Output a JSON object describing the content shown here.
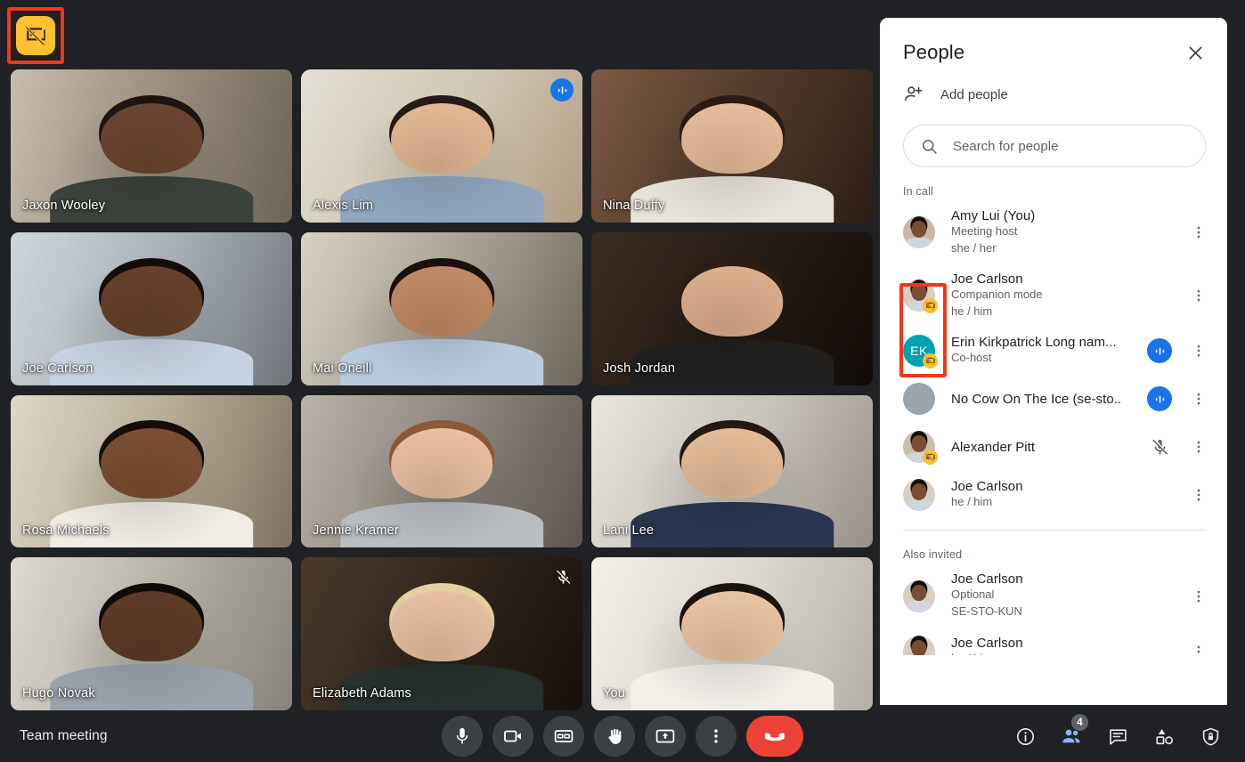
{
  "meeting": {
    "title": "Team meeting",
    "companion_indicator_icon": "companion-mode-off-icon"
  },
  "video_grid": {
    "tiles": [
      {
        "name": "Jaxon Wooley",
        "speaking": false,
        "muted": false,
        "audio_active": false
      },
      {
        "name": "Alexis Lim",
        "speaking": true,
        "muted": false,
        "audio_active": true
      },
      {
        "name": "Nina Duffy",
        "speaking": false,
        "muted": false,
        "audio_active": false
      },
      {
        "name": "Joe Carlson",
        "speaking": false,
        "muted": false,
        "audio_active": false
      },
      {
        "name": "Mai Oneill",
        "speaking": false,
        "muted": false,
        "audio_active": false
      },
      {
        "name": "Josh Jordan",
        "speaking": false,
        "muted": false,
        "audio_active": false
      },
      {
        "name": "Rosa Michaels",
        "speaking": false,
        "muted": false,
        "audio_active": false
      },
      {
        "name": "Jennie Kramer",
        "speaking": false,
        "muted": false,
        "audio_active": false
      },
      {
        "name": "Lani Lee",
        "speaking": false,
        "muted": false,
        "audio_active": false
      },
      {
        "name": "Hugo Novak",
        "speaking": false,
        "muted": false,
        "audio_active": false
      },
      {
        "name": "Elizabeth Adams",
        "speaking": false,
        "muted": true,
        "audio_active": false
      },
      {
        "name": "You",
        "speaking": false,
        "muted": false,
        "audio_active": false
      }
    ]
  },
  "people_panel": {
    "title": "People",
    "close_label": "Close",
    "add_people_label": "Add people",
    "search_placeholder": "Search for people",
    "search_value": "",
    "sections": [
      {
        "label": "In call",
        "people": [
          {
            "name": "Amy Lui (You)",
            "sub1": "Meeting host",
            "sub2": "she / her",
            "avatar": "photo",
            "avatar_color": "#c9b8a8",
            "companion": false,
            "audio_active": false,
            "muted": false
          },
          {
            "name": "Joe Carlson",
            "sub1": "Companion mode",
            "sub2": "he / him",
            "avatar": "photo",
            "avatar_color": "#d8cfc4",
            "companion": true,
            "audio_active": false,
            "muted": false
          },
          {
            "name": "Erin Kirkpatrick Long nam...",
            "sub1": "Co-host",
            "sub2": "",
            "avatar": "initials",
            "initials": "EK",
            "avatar_color": "#00a0af",
            "companion": true,
            "audio_active": true,
            "muted": false
          },
          {
            "name": "No Cow On The Ice (se-sto..",
            "sub1": "",
            "sub2": "",
            "avatar": "blank",
            "avatar_color": "#9aa5ab",
            "companion": false,
            "audio_active": true,
            "muted": false
          },
          {
            "name": "Alexander Pitt",
            "sub1": "",
            "sub2": "",
            "avatar": "photo",
            "avatar_color": "#cbbfae",
            "companion": true,
            "audio_active": false,
            "muted": true
          },
          {
            "name": "Joe Carlson",
            "sub1": "he / him",
            "sub2": "",
            "avatar": "photo",
            "avatar_color": "#d8cfc4",
            "companion": false,
            "audio_active": false,
            "muted": false
          }
        ]
      },
      {
        "label": "Also invited",
        "people": [
          {
            "name": "Joe Carlson",
            "sub1": "Optional",
            "sub2": "SE-STO-KUN",
            "avatar": "photo",
            "avatar_color": "#d8cfc4",
            "companion": false,
            "audio_active": false,
            "muted": false
          },
          {
            "name": "Joe Carlson",
            "sub1": "he / him",
            "sub2": "",
            "avatar": "photo",
            "avatar_color": "#d8cfc4",
            "companion": false,
            "audio_active": false,
            "muted": false
          }
        ]
      }
    ]
  },
  "bottom_bar": {
    "center_controls": [
      {
        "name": "microphone-button",
        "icon": "microphone-icon"
      },
      {
        "name": "camera-button",
        "icon": "video-camera-icon"
      },
      {
        "name": "captions-button",
        "icon": "closed-captions-icon"
      },
      {
        "name": "raise-hand-button",
        "icon": "raised-hand-icon"
      },
      {
        "name": "present-now-button",
        "icon": "present-screen-icon"
      },
      {
        "name": "more-options-button",
        "icon": "more-vertical-icon"
      }
    ],
    "end_call": {
      "name": "end-call-button",
      "icon": "phone-hangup-icon"
    },
    "right_controls": [
      {
        "name": "meeting-details-button",
        "icon": "info-icon",
        "active": false,
        "badge": ""
      },
      {
        "name": "people-panel-button",
        "icon": "people-icon",
        "active": true,
        "badge": "4"
      },
      {
        "name": "chat-panel-button",
        "icon": "chat-bubble-icon",
        "active": false,
        "badge": ""
      },
      {
        "name": "activities-button",
        "icon": "activities-shapes-icon",
        "active": false,
        "badge": ""
      },
      {
        "name": "host-controls-button",
        "icon": "shield-lock-icon",
        "active": false,
        "badge": ""
      }
    ]
  },
  "colors": {
    "accent_blue": "#1a73e8",
    "speaking_border": "#4285f4",
    "companion_yellow": "#fdc02f",
    "highlight_red": "#f4351a",
    "end_call_red": "#ea4335",
    "panel_bg": "#ffffff",
    "app_bg": "#202124"
  }
}
